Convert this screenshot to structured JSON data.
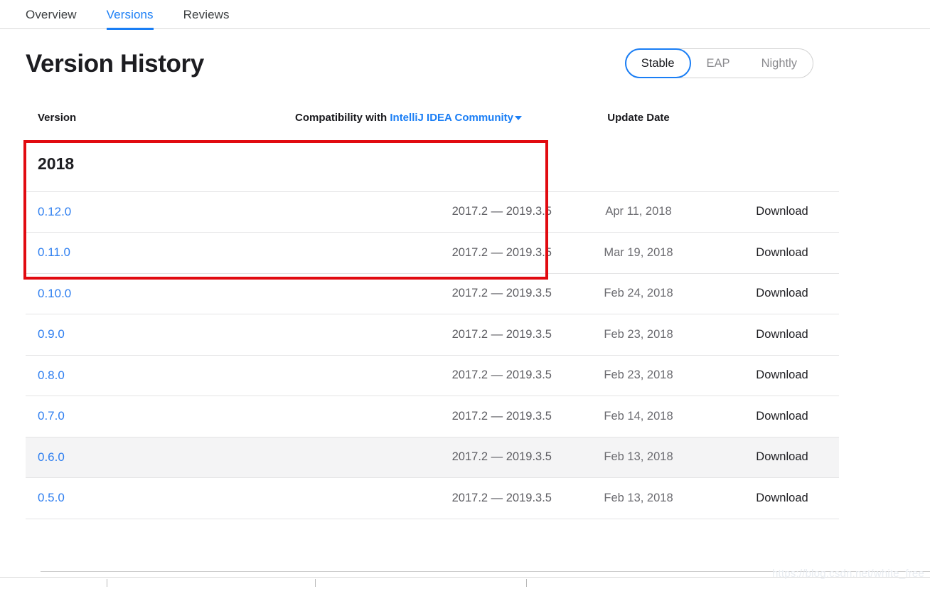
{
  "nav": {
    "tabs": [
      {
        "label": "Overview",
        "active": false
      },
      {
        "label": "Versions",
        "active": true
      },
      {
        "label": "Reviews",
        "active": false
      }
    ]
  },
  "header": {
    "title": "Version History"
  },
  "channel_toggle": {
    "options": [
      {
        "label": "Stable",
        "selected": true
      },
      {
        "label": "EAP",
        "selected": false
      },
      {
        "label": "Nightly",
        "selected": false
      }
    ]
  },
  "table": {
    "headers": {
      "version": "Version",
      "compatibility_prefix": "Compatibility with",
      "compatibility_product": "IntelliJ IDEA Community",
      "update_date": "Update Date",
      "download": ""
    },
    "group_label": "2018",
    "download_label": "Download",
    "rows": [
      {
        "version": "0.12.0",
        "compatibility": "2017.2 — 2019.3.5",
        "date": "Apr 11, 2018",
        "download": "Download",
        "highlighted": false
      },
      {
        "version": "0.11.0",
        "compatibility": "2017.2 — 2019.3.5",
        "date": "Mar 19, 2018",
        "download": "Download",
        "highlighted": false
      },
      {
        "version": "0.10.0",
        "compatibility": "2017.2 — 2019.3.5",
        "date": "Feb 24, 2018",
        "download": "Download",
        "highlighted": false
      },
      {
        "version": "0.9.0",
        "compatibility": "2017.2 — 2019.3.5",
        "date": "Feb 23, 2018",
        "download": "Download",
        "highlighted": false
      },
      {
        "version": "0.8.0",
        "compatibility": "2017.2 — 2019.3.5",
        "date": "Feb 23, 2018",
        "download": "Download",
        "highlighted": false
      },
      {
        "version": "0.7.0",
        "compatibility": "2017.2 — 2019.3.5",
        "date": "Feb 14, 2018",
        "download": "Download",
        "highlighted": false
      },
      {
        "version": "0.6.0",
        "compatibility": "2017.2 — 2019.3.5",
        "date": "Feb 13, 2018",
        "download": "Download",
        "highlighted": true
      },
      {
        "version": "0.5.0",
        "compatibility": "2017.2 — 2019.3.5",
        "date": "Feb 13, 2018",
        "download": "Download",
        "highlighted": false
      }
    ]
  },
  "annotation": {
    "color": "#e10a10"
  },
  "watermark": {
    "text": "https://blog.csdn.net/white_free"
  },
  "colors": {
    "link_blue": "#2f7ff0",
    "accent_blue": "#1a7ef5",
    "row_highlight": "#f4f4f5",
    "annotation_red": "#e10a10"
  }
}
